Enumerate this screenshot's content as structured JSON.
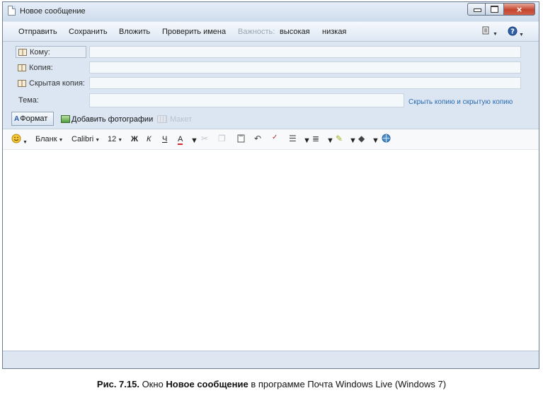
{
  "window": {
    "title": "Новое сообщение",
    "close_glyph": "×"
  },
  "commands": {
    "send": "Отправить",
    "save": "Сохранить",
    "attach": "Вложить",
    "check_names": "Проверить имена",
    "importance": "Важность:",
    "high": "высокая",
    "low": "низкая"
  },
  "headers": {
    "to_label": "Кому:",
    "cc_label": "Копия:",
    "bcc_label": "Скрытая копия:",
    "subject_label": "Тема:",
    "hide_cc_bcc_link": "Скрыть копию и скрытую копию",
    "to_value": "",
    "cc_value": "",
    "bcc_value": "",
    "subject_value": ""
  },
  "format_bar": {
    "format_label": "Формат",
    "format_icon": "A",
    "add_photos_label": "Добавить фотографии",
    "layout_label": "Макет"
  },
  "formatting": {
    "stationery": "Бланк",
    "font_name": "Calibri",
    "font_size": "12",
    "bold": "Ж",
    "italic": "К",
    "underline": "Ч",
    "font_color": "А"
  },
  "caption": {
    "prefix": "Рис. 7.15.",
    "part1": " Окно ",
    "bold": "Новое сообщение",
    "part2": " в программе Почта Windows Live (Windows 7)"
  },
  "colors": {
    "chrome": "#dbe6f3",
    "link": "#2a6bb0",
    "close_button": "#c4452f"
  }
}
